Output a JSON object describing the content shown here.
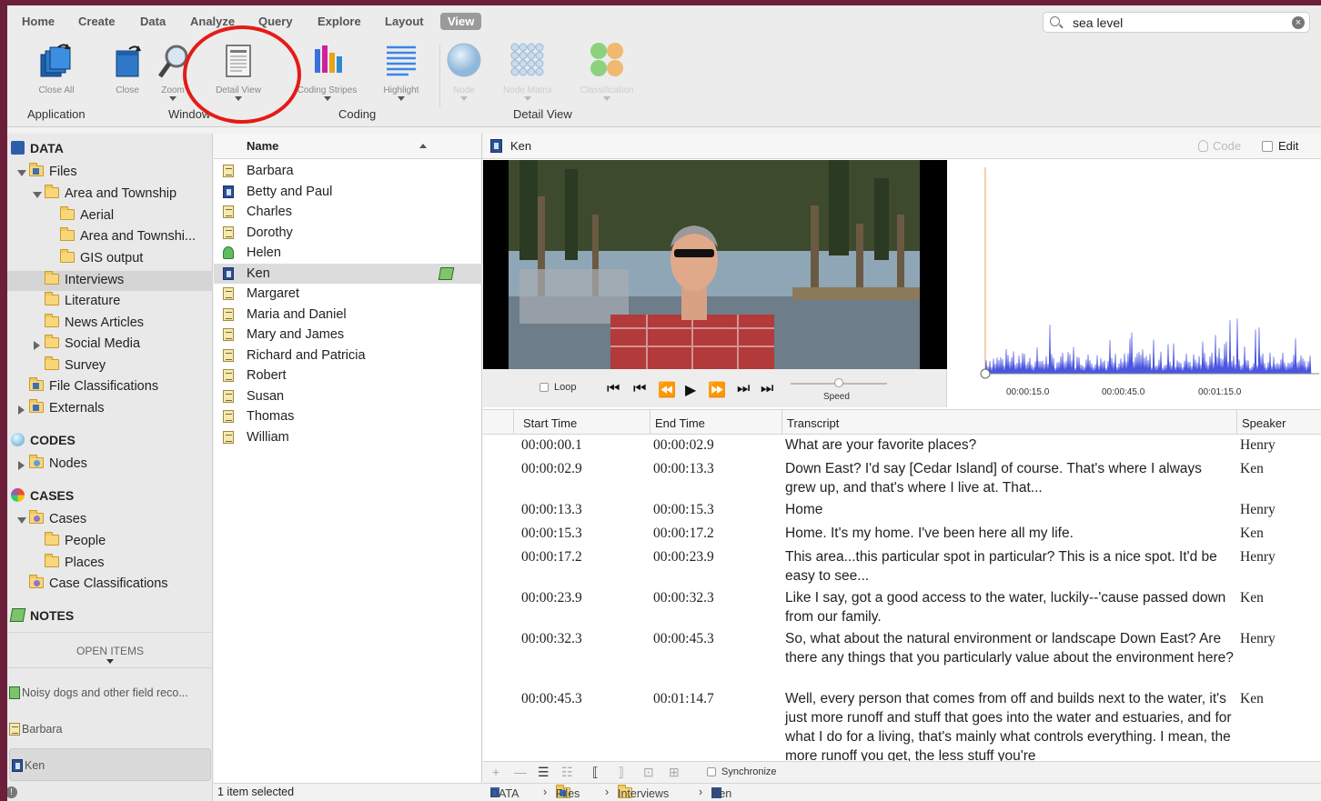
{
  "menu": {
    "tabs": [
      "Home",
      "Create",
      "Data",
      "Analyze",
      "Query",
      "Explore",
      "Layout",
      "View"
    ],
    "active": "View"
  },
  "search": {
    "value": "sea level",
    "clear_icon": "clear-icon"
  },
  "ribbon": {
    "buttons": {
      "close_all": "Close All",
      "close": "Close",
      "zoom": "Zoom",
      "detail_view": "Detail View",
      "coding_stripes": "Coding Stripes",
      "highlight": "Highlight",
      "node": "Node",
      "node_matrix": "Node Matrix",
      "classification": "Classification"
    },
    "groups": {
      "application": "Application",
      "window": "Window",
      "coding": "Coding",
      "detail_view": "Detail View"
    }
  },
  "nav": {
    "data_header": "DATA",
    "files": "Files",
    "area_and_township": "Area and Township",
    "aerial": "Aerial",
    "area_and_township_2": "Area and Townshi...",
    "gis_output": "GIS output",
    "interviews": "Interviews",
    "literature": "Literature",
    "news_articles": "News Articles",
    "social_media": "Social Media",
    "survey": "Survey",
    "file_classifications": "File Classifications",
    "externals": "Externals",
    "codes_header": "CODES",
    "nodes": "Nodes",
    "cases_header": "CASES",
    "cases": "Cases",
    "people": "People",
    "places": "Places",
    "case_classifications": "Case Classifications",
    "notes_header": "NOTES",
    "open_items_label": "OPEN ITEMS",
    "open_items": [
      "Noisy dogs and other field reco...",
      "Barbara",
      "Ken"
    ]
  },
  "list": {
    "column_name": "Name",
    "items": [
      {
        "name": "Barbara",
        "type": "document"
      },
      {
        "name": "Betty and Paul",
        "type": "video"
      },
      {
        "name": "Charles",
        "type": "document"
      },
      {
        "name": "Dorothy",
        "type": "document"
      },
      {
        "name": "Helen",
        "type": "audio"
      },
      {
        "name": "Ken",
        "type": "video"
      },
      {
        "name": "Margaret",
        "type": "document"
      },
      {
        "name": "Maria and Daniel",
        "type": "document"
      },
      {
        "name": "Mary and James",
        "type": "document"
      },
      {
        "name": "Richard and Patricia",
        "type": "document"
      },
      {
        "name": "Robert",
        "type": "document"
      },
      {
        "name": "Susan",
        "type": "document"
      },
      {
        "name": "Thomas",
        "type": "document"
      },
      {
        "name": "William",
        "type": "document"
      }
    ],
    "status": "1 item selected"
  },
  "detail": {
    "title": "Ken",
    "code_label": "Code",
    "edit_label": "Edit",
    "loop_label": "Loop",
    "speed_label": "Speed",
    "timeline_labels": [
      "00:00:15.0",
      "00:00:45.0",
      "00:01:15.0"
    ],
    "columns": [
      "Start Time",
      "End Time",
      "Transcript",
      "Speaker"
    ],
    "rows": [
      {
        "start": "00:00:00.1",
        "end": "00:00:02.9",
        "text": "What are your favorite places?",
        "speaker": "Henry"
      },
      {
        "start": "00:00:02.9",
        "end": "00:00:13.3",
        "text": "Down East? I'd say [Cedar Island] of course. That's where I always grew up, and that's where I live at. That...",
        "speaker": "Ken"
      },
      {
        "start": "00:00:13.3",
        "end": "00:00:15.3",
        "text": "Home",
        "speaker": "Henry"
      },
      {
        "start": "00:00:15.3",
        "end": "00:00:17.2",
        "text": "Home. It's my home. I've been here all my life.",
        "speaker": "Ken"
      },
      {
        "start": "00:00:17.2",
        "end": "00:00:23.9",
        "text": "This area...this particular spot in particular? This is a nice spot. It'd be easy to see...",
        "speaker": "Henry"
      },
      {
        "start": "00:00:23.9",
        "end": "00:00:32.3",
        "text": "Like I say, got a good access to the water, luckily--'cause passed down from our family.",
        "speaker": "Ken"
      },
      {
        "start": "00:00:32.3",
        "end": "00:00:45.3",
        "text": "So, what about the natural environment or landscape Down East? Are there any things that you particularly value about the environment here?",
        "speaker": "Henry"
      },
      {
        "start": "00:00:45.3",
        "end": "00:01:14.7",
        "text": "Well, every person that comes from off and builds next to the water, it's just more runoff and stuff that goes into the water and estuaries, and for what I do for a living, that's mainly what controls everything. I mean, the more runoff you get, the less stuff you're",
        "speaker": "Ken"
      }
    ],
    "synchronize_label": "Synchronize",
    "breadcrumb": [
      "DATA",
      "Files",
      "Interviews",
      "Ken"
    ]
  },
  "colors": {
    "accent": "#e41b17",
    "waveform": "#4a55e0",
    "frame": "#6b1f3a"
  }
}
